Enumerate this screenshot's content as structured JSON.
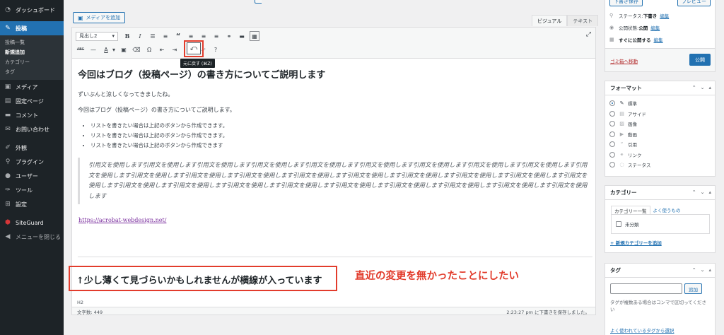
{
  "sidebar": {
    "items": [
      {
        "label": "ダッシュボード",
        "icon": "dashboard-icon",
        "glyph": "◔"
      },
      {
        "label": "投稿",
        "icon": "pin-icon",
        "glyph": "✎",
        "active": true
      },
      {
        "label": "メディア",
        "icon": "media-icon",
        "glyph": "▣"
      },
      {
        "label": "固定ページ",
        "icon": "page-icon",
        "glyph": "▤"
      },
      {
        "label": "コメント",
        "icon": "comment-icon",
        "glyph": "▬"
      },
      {
        "label": "お問い合わせ",
        "icon": "mail-icon",
        "glyph": "✉"
      },
      {
        "label": "外観",
        "icon": "appearance-icon",
        "glyph": "✐"
      },
      {
        "label": "プラグイン",
        "icon": "plugin-icon",
        "glyph": "⚲"
      },
      {
        "label": "ユーザー",
        "icon": "user-icon",
        "glyph": "●"
      },
      {
        "label": "ツール",
        "icon": "tools-icon",
        "glyph": "✑"
      },
      {
        "label": "設定",
        "icon": "settings-icon",
        "glyph": "⊞"
      },
      {
        "label": "SiteGuard",
        "icon": "siteguard-icon",
        "glyph": "⬢"
      },
      {
        "label": "メニューを閉じる",
        "icon": "collapse-icon",
        "glyph": "◀"
      }
    ],
    "submenu": [
      "投稿一覧",
      "新規追加",
      "カテゴリー",
      "タグ"
    ]
  },
  "editor": {
    "add_media": "メディアを追加",
    "tab_visual": "ビジュアル",
    "tab_text": "テキスト",
    "format_select": "見出し2",
    "undo_glyph": "⤺",
    "undo_tooltip": "元に戻す (⌘Z)",
    "heading": "今回はブログ（投稿ページ）の書き方についてご説明します",
    "para1": "ずいぶんと涼しくなってきましたね。",
    "para2": "今回はブログ（投稿ページ）の書き方についてご説明します。",
    "list": [
      "リストを書きたい場合は上記のボタンから作成できます。",
      "リストを書きたい場合は上記のボタンから作成できます。",
      "リストを書きたい場合は上記のボタンから作成できます"
    ],
    "blockquote": "引用文を使用します引用文を使用します引用文を使用します引用文を使用します引用文を使用します引用文を使用します引用文を使用します引用文を使用します引用文を使用します引用文を使用します引用文を使用します引用文を使用します引用文を使用します引用文を使用します引用文を使用します引用文を使用します引用文を使用します引用文を使用します引用文を使用します引用文を使用します引用文を使用します引用文を使用します引用文を使用します引用文を使用します引用文を使用します引用文を使用します引用文を使用します引用文を使用します",
    "link": "https://acrobat-webdesign.net/",
    "new_heading": "↑少し薄くて見づらいかもしれませんが横線が入っています",
    "path": "H2",
    "word_count": "文字数: 449",
    "autosave": "2:23:27 pm に下書きを保存しました。"
  },
  "annotation": "直近の変更を無かったことにしたい",
  "publish": {
    "save_draft": "下書き保存",
    "preview": "プレビュー",
    "status_label": "ステータス: ",
    "status_value": "下書き",
    "visibility_label": "公開状態: ",
    "visibility_value": "公開",
    "schedule": "すぐに公開する",
    "edit": "編集",
    "trash": "ゴミ箱へ移動",
    "publish_btn": "公開"
  },
  "format_box": {
    "title": "フォーマット",
    "options": [
      "標準",
      "アサイド",
      "画像",
      "動画",
      "引用",
      "リンク",
      "ステータス"
    ]
  },
  "category_box": {
    "title": "カテゴリー",
    "tab_all": "カテゴリー一覧",
    "tab_popular": "よく使うもの",
    "item": "未分類",
    "add_new": "+ 新規カテゴリーを追加"
  },
  "tag_box": {
    "title": "タグ",
    "add_btn": "追加",
    "help": "タグが複数ある場合はコンマで区切ってください",
    "popular": "よく使われているタグから選択"
  },
  "colors": {
    "admin_bar": "#1d2327",
    "accent": "#2271b1",
    "highlight_red": "#e23c2c"
  }
}
